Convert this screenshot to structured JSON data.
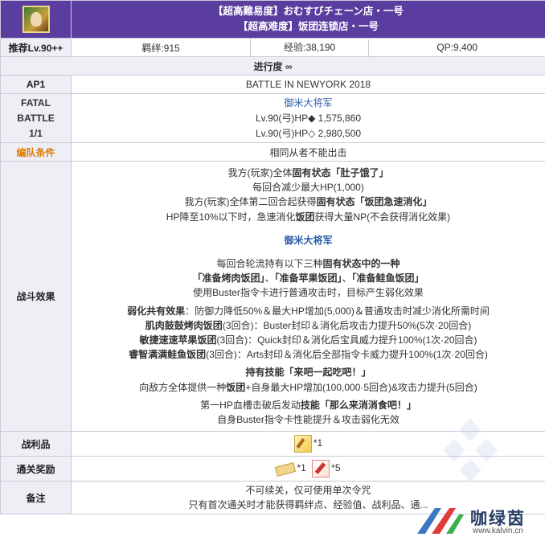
{
  "header": {
    "title_jp": "【超高難易度】おむすびチェーン店・一号",
    "title_cn": "【超高难度】饭团连锁店・一号"
  },
  "stats": {
    "level_label": "推荐Lv.90++",
    "bond": "羁绊:915",
    "exp": "经验:38,190",
    "qp": "QP:9,400"
  },
  "progress": "进行度 ∞",
  "ap": {
    "label": "AP1",
    "value": "BATTLE IN NEWYORK 2018"
  },
  "fatal": {
    "label_lines": [
      "FATAL",
      "BATTLE",
      "1/1"
    ],
    "enemy_name": "御米大将军",
    "hp_lines": [
      "Lv.90(弓)HP◆ 1,575,860",
      "Lv.90(弓)HP◇ 2,980,500"
    ]
  },
  "formation": {
    "label": "编队条件",
    "value": "相同从者不能出击"
  },
  "battle_effect": {
    "label": "战斗效果",
    "p1": [
      "我方(玩家)全体固有状态「肚子饿了」",
      "每回合减少最大HP(1,000)",
      "我方(玩家)全体第二回合起获得固有状态「饭团急速消化」",
      "HP降至10%以下时，急速消化饭团获得大量NP(不会获得消化效果)"
    ],
    "boss": "御米大将军",
    "p2": [
      "每回合轮流持有以下三种固有状态中的一种",
      "「准备烤肉饭团」、「准备苹果饭团」、「准备鲑鱼饭团」",
      "使用Buster指令卡进行普通攻击时，目标产生弱化效果"
    ],
    "p3": [
      "弱化共有效果：防御力降低50%＆最大HP增加(5,000)＆普通攻击时减少消化所需时间",
      "肌肉鼓鼓烤肉饭团(3回合)：Buster封印＆消化后攻击力提升50%(5次·20回合)",
      "敏捷速速苹果饭团(3回合)：Quick封印＆消化后宝具威力提升100%(1次·20回合)",
      "睿智满满鲑鱼饭团(3回合)：Arts封印＆消化后全部指令卡威力提升100%(1次·20回合)"
    ],
    "p4": [
      "持有技能「来吧一起吃吧！」",
      "向敌方全体提供一种饭团+自身最大HP增加(100,000·5回合)&攻击力提升(5回合)"
    ],
    "p5": [
      "第一HP血槽击破后发动技能「那么来消消食吧！」",
      "自身Buster指令卡性能提升＆攻击弱化无效"
    ]
  },
  "loot": {
    "label": "战利品",
    "count": "*1",
    "icon": "golden-spoon-icon"
  },
  "reward": {
    "label": "通关奖励",
    "items": [
      {
        "icon": "ticket-icon",
        "count": "*1"
      },
      {
        "icon": "mana-prism-icon",
        "count": "*5"
      }
    ]
  },
  "notes": {
    "label": "备注",
    "lines": [
      "不可续关，仅可使用单次令咒",
      "只有首次通关时才能获得羁绊点、经验值、战利品、通..."
    ]
  },
  "watermark": {
    "text": "咖绿茵",
    "url": "www.kalvin.cn"
  },
  "colors": {
    "header_bg": "#5b3da0",
    "label_bg": "#eeeef5",
    "accent_blue": "#2a5ea8",
    "accent_orange": "#e07b00"
  }
}
